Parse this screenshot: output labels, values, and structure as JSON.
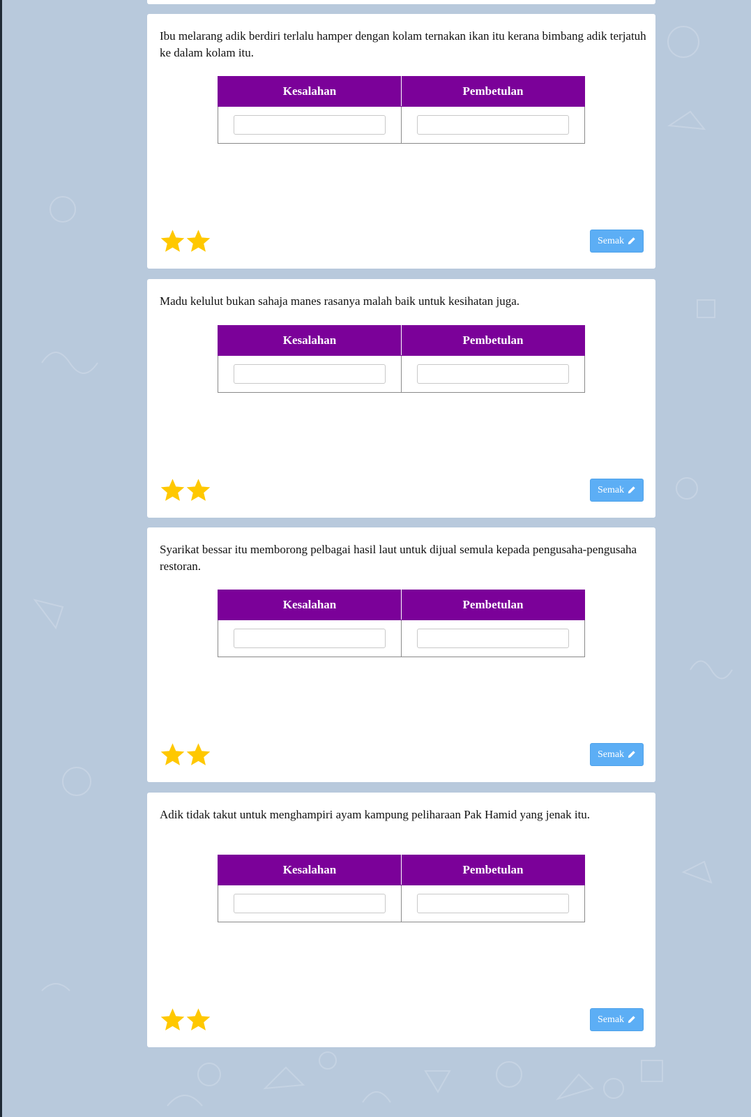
{
  "colors": {
    "page_background": "#b8c9dc",
    "table_header": "#7b0199",
    "star": "#ffc800",
    "button": "#5caef5"
  },
  "table_headers": {
    "error": "Kesalahan",
    "correction": "Pembetulan"
  },
  "questions": [
    {
      "text": "Ibu melarang adik berdiri terlalu hamper dengan kolam ternakan ikan itu kerana bimbang adik terjatuh ke dalam kolam itu.",
      "error_value": "",
      "correction_value": "",
      "stars": 2,
      "button_label": "Semak",
      "button_icon": "pencil-icon"
    },
    {
      "text": "Madu kelulut bukan sahaja manes rasanya malah baik untuk kesihatan juga.",
      "error_value": "",
      "correction_value": "",
      "stars": 2,
      "button_label": "Semak",
      "button_icon": "pencil-icon"
    },
    {
      "text": "Syarikat bessar itu memborong pelbagai hasil laut untuk dijual semula kepada pengusaha-pengusaha restoran.",
      "error_value": "",
      "correction_value": "",
      "stars": 2,
      "button_label": "Semak",
      "button_icon": "pencil-icon"
    },
    {
      "text": "Adik tidak takut untuk menghampiri ayam kampung peliharaan Pak Hamid yang jenak itu.",
      "error_value": "",
      "correction_value": "",
      "stars": 2,
      "button_label": "Semak",
      "button_icon": "pencil-icon"
    }
  ]
}
